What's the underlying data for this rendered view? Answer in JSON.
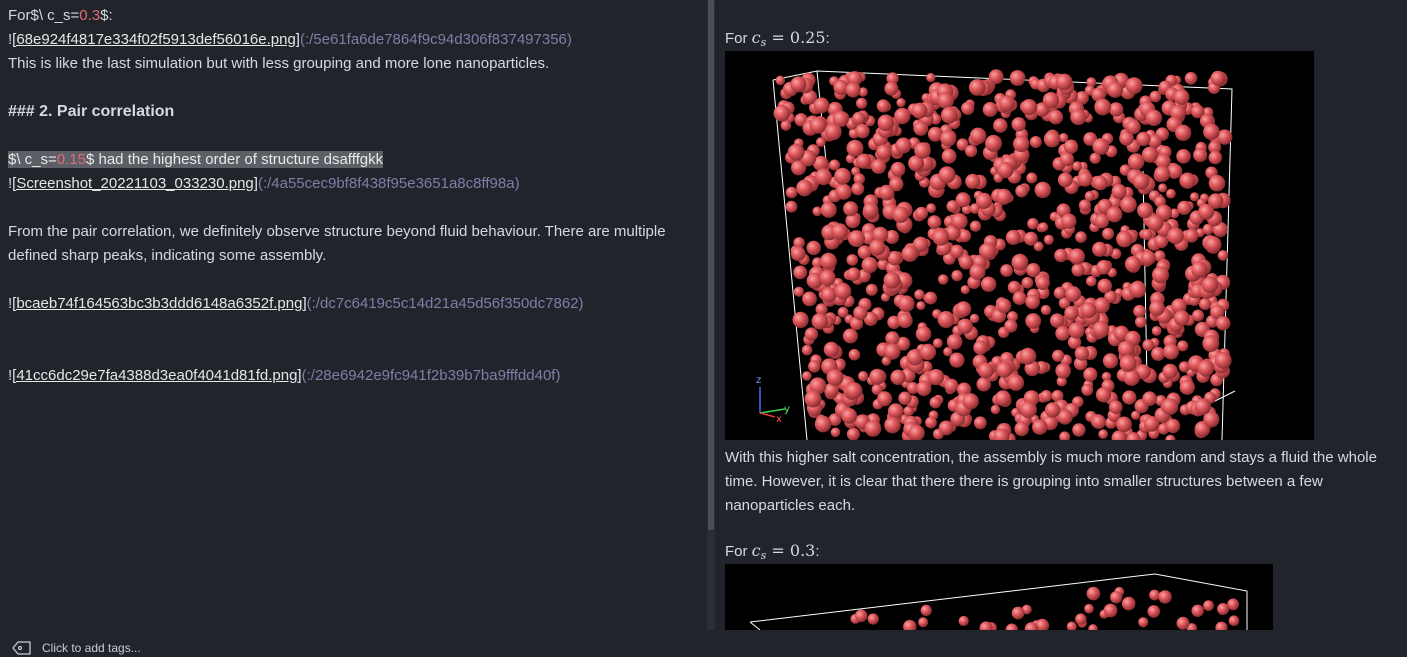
{
  "editor": {
    "line1": {
      "a": "For$\\ c_s=",
      "num": "0.3",
      "b": "$:"
    },
    "line2": {
      "bang": "!",
      "link": "[68e924f4817e334f02f5913def56016e.png]",
      "url": "(:/5e61fa6de7864f9c94d306f837497356)"
    },
    "line3": "This is like the last simulation but with less grouping and more lone nanoparticles.",
    "heading": "### 2. Pair correlation",
    "line5": {
      "a": "$\\ c_s=",
      "num": "0.15",
      "b": "$ had the highest order of structure dsafffgkk"
    },
    "line6": {
      "bang": "!",
      "link": "[Screenshot_20221103_033230.png]",
      "url": "(:/4a55cec9bf8f438f95e3651a8c8ff98a)"
    },
    "para1": "From the pair correlation, we definitely observe structure beyond fluid behaviour. There are multiple",
    "para2": "defined sharp peaks, indicating some assembly.",
    "line9": {
      "bang": "!",
      "link": "[bcaeb74f164563bc3b3ddd6148a6352f.png]",
      "url": "(:/dc7c6419c5c14d21a45d56f350dc7862)"
    },
    "line10": {
      "bang": "!",
      "link": "[41cc6dc29e7fa4388d3ea0f4041d81fd.png]",
      "url": "(:/28e6942e9fc941f2b39b7ba9fffdd40f)"
    }
  },
  "viewer": {
    "cs1": {
      "for": "For",
      "c": "c",
      "s": "s",
      "eq": "= 0.25",
      "colon": ":"
    },
    "para1": "With this higher salt concentration, the assembly is much more random and stays a fluid the whole",
    "para2": "time. However, it is clear that there there is grouping into smaller structures between a few",
    "para3": "nanoparticles each.",
    "cs2": {
      "for": "For",
      "c": "c",
      "s": "s",
      "eq": "= 0.3",
      "colon": ":"
    },
    "axes": {
      "z": "z",
      "y": "y",
      "x": "x"
    }
  },
  "footer": {
    "tags_label": "Click to add tags..."
  },
  "colors": {
    "sphere": "#e15a5e",
    "background": "#21252b",
    "accent_num": "#e06c75",
    "render_bg": "#000000"
  }
}
